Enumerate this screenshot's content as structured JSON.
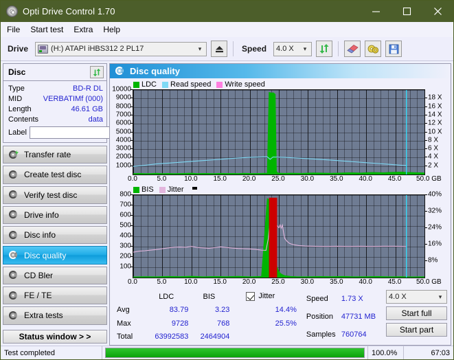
{
  "window": {
    "title": "Opti Drive Control 1.70",
    "app_icon": "disc-icon",
    "minimize": "minimize-icon",
    "maximize": "maximize-icon",
    "close": "close-icon"
  },
  "menu": {
    "items": [
      {
        "label": "File"
      },
      {
        "label": "Start test"
      },
      {
        "label": "Extra"
      },
      {
        "label": "Help"
      }
    ]
  },
  "toolbar": {
    "drive_label": "Drive",
    "drive_value": "(H:)   ATAPI iHBS312  2 PL17",
    "eject_icon": "eject-icon",
    "speed_label": "Speed",
    "speed_value": "4.0 X",
    "refresh_icon": "refresh-icon",
    "erase_icon": "eraser-icon",
    "disc_tools_icon": "disc-tools-icon",
    "save_icon": "save-icon"
  },
  "disc_panel": {
    "title": "Disc",
    "refresh_icon": "refresh-icon",
    "rows": [
      {
        "key": "Type",
        "value": "BD-R DL"
      },
      {
        "key": "MID",
        "value": "VERBATIMf (000)"
      },
      {
        "key": "Length",
        "value": "46.61 GB"
      },
      {
        "key": "Contents",
        "value": "data"
      }
    ],
    "label_key": "Label",
    "label_value": "",
    "label_placeholder": "",
    "label_button_icon": "disc-icon"
  },
  "sidebar": {
    "items": [
      {
        "label": "Transfer rate",
        "active": false
      },
      {
        "label": "Create test disc",
        "active": false
      },
      {
        "label": "Verify test disc",
        "active": false
      },
      {
        "label": "Drive info",
        "active": false
      },
      {
        "label": "Disc info",
        "active": false
      },
      {
        "label": "Disc quality",
        "active": true
      },
      {
        "label": "CD Bler",
        "active": false
      },
      {
        "label": "FE / TE",
        "active": false
      },
      {
        "label": "Extra tests",
        "active": false
      }
    ],
    "status_window_button": "Status window > >"
  },
  "main": {
    "title": "Disc quality",
    "icon": "disc-quality-icon"
  },
  "stats": {
    "col_headers": [
      "LDC",
      "BIS"
    ],
    "rows": [
      {
        "key": "Avg",
        "ldc": "83.79",
        "bis": "3.23",
        "jitter": "14.4%"
      },
      {
        "key": "Max",
        "ldc": "9728",
        "bis": "768",
        "jitter": "25.5%"
      },
      {
        "key": "Total",
        "ldc": "63992583",
        "bis": "2464904",
        "jitter": ""
      }
    ],
    "jitter_label": "Jitter",
    "jitter_checked": true,
    "speed_label": "Speed",
    "speed_value": "1.73 X",
    "position_label": "Position",
    "position_value": "47731 MB",
    "samples_label": "Samples",
    "samples_value": "760764",
    "speed_select": "4.0 X",
    "start_full": "Start full",
    "start_part": "Start part"
  },
  "statusbar": {
    "message": "Test completed",
    "progress_percent": 100,
    "progress_text": "100.0%",
    "elapsed": "67:03"
  },
  "colors": {
    "titlebar": "#4c5e2a",
    "accent_blue": "#2323d0",
    "ldc_green": "#00b400",
    "bis_green": "#00b400",
    "read_speed": "#7fd9f5",
    "write_speed": "#ff7fe0",
    "jitter_pink": "#e3b6dd",
    "marker_cyan": "#33e0ff",
    "spike_red": "#cc0000",
    "plot_bg": "#6f7c93",
    "progress_green": "#0aa30a"
  },
  "chart_data": [
    {
      "type": "area",
      "id": "ldc-chart",
      "title": "LDC / Read speed",
      "xlabel": "GB",
      "ylabel": "LDC",
      "xlim": [
        0,
        50
      ],
      "ylim": [
        0,
        10000
      ],
      "y2lim": [
        0,
        20
      ],
      "y2label": "X",
      "grid": true,
      "legend": [
        "LDC",
        "Read speed",
        "Write speed"
      ],
      "legend_position": "top-left",
      "xticks": [
        "0.0",
        "5.0",
        "10.0",
        "15.0",
        "20.0",
        "25.0",
        "30.0",
        "35.0",
        "40.0",
        "45.0",
        "50.0 GB"
      ],
      "yticks": [
        "10000",
        "9000",
        "8000",
        "7000",
        "6000",
        "5000",
        "4000",
        "3000",
        "2000",
        "1000"
      ],
      "y2ticks": [
        "18 X",
        "16 X",
        "14 X",
        "12 X",
        "10 X",
        "8 X",
        "6 X",
        "4 X",
        "2 X"
      ],
      "series": [
        {
          "name": "LDC",
          "color": "#00b400",
          "kind": "bars",
          "x": [
            0,
            1,
            2,
            3,
            4,
            5,
            6,
            7,
            8,
            9,
            10,
            11,
            12,
            13,
            14,
            15,
            16,
            17,
            18,
            19,
            20,
            21,
            22,
            23,
            23.3,
            23.5,
            23.8,
            24.0,
            24.2,
            24.4,
            24.6,
            24.8,
            25.0,
            25.4,
            26,
            27,
            28,
            29,
            30,
            31,
            32,
            33,
            34,
            35,
            36,
            37,
            38,
            39,
            40,
            41,
            42,
            43,
            44,
            45,
            46,
            47,
            48,
            49,
            50
          ],
          "values": [
            120,
            150,
            110,
            130,
            160,
            120,
            140,
            110,
            130,
            150,
            170,
            120,
            140,
            130,
            120,
            150,
            130,
            140,
            120,
            160,
            140,
            130,
            150,
            170,
            9728,
            9700,
            9650,
            9700,
            9600,
            9500,
            400,
            200,
            180,
            160,
            150,
            170,
            160,
            150,
            180,
            200,
            190,
            170,
            160,
            180,
            200,
            220,
            210,
            190,
            230,
            250,
            240,
            220,
            260,
            280,
            300,
            260,
            240,
            220,
            200
          ]
        },
        {
          "name": "Read speed",
          "color": "#7fd9f5",
          "kind": "line",
          "x": [
            0,
            2,
            4,
            6,
            8,
            10,
            12,
            14,
            16,
            18,
            20,
            22,
            23,
            23.5,
            24,
            25,
            26,
            28,
            30,
            32,
            34,
            36,
            38,
            40,
            42,
            44,
            46,
            47
          ],
          "values": [
            1.9,
            2.2,
            2.5,
            2.7,
            2.9,
            3.1,
            3.3,
            3.5,
            3.7,
            3.9,
            4.05,
            4.15,
            4.2,
            3.6,
            4.15,
            4.1,
            4.05,
            3.9,
            3.75,
            3.6,
            3.4,
            3.2,
            3.0,
            2.8,
            2.6,
            2.4,
            2.2,
            2.1
          ]
        },
        {
          "name": "Write speed",
          "color": "#ff7fe0",
          "kind": "line",
          "x": [],
          "values": []
        },
        {
          "name": "End marker",
          "color": "#33e0ff",
          "kind": "vline",
          "x": [
            46.9
          ],
          "values": []
        }
      ]
    },
    {
      "type": "area",
      "id": "bis-jitter-chart",
      "title": "BIS / Jitter",
      "xlabel": "GB",
      "ylabel": "BIS",
      "xlim": [
        0,
        50
      ],
      "ylim": [
        0,
        800
      ],
      "y2lim": [
        0,
        40
      ],
      "y2label": "%",
      "grid": true,
      "legend": [
        "BIS",
        "Jitter"
      ],
      "legend_position": "top-left",
      "xticks": [
        "0.0",
        "5.0",
        "10.0",
        "15.0",
        "20.0",
        "25.0",
        "30.0",
        "35.0",
        "40.0",
        "45.0",
        "50.0 GB"
      ],
      "yticks": [
        "800",
        "700",
        "600",
        "500",
        "400",
        "300",
        "200",
        "100"
      ],
      "y2ticks": [
        "40%",
        "32%",
        "24%",
        "16%",
        "8%"
      ],
      "series": [
        {
          "name": "BIS",
          "color": "#00b400",
          "kind": "bars",
          "x": [
            0,
            2,
            4,
            6,
            8,
            10,
            12,
            14,
            16,
            18,
            20,
            22,
            23,
            23.3,
            23.5,
            23.8,
            24.0,
            24.3,
            24.6,
            25.0,
            25.3,
            25.6,
            26,
            27,
            28,
            30,
            32,
            34,
            36,
            38,
            40,
            42,
            44,
            46,
            48,
            50
          ],
          "values": [
            8,
            10,
            9,
            12,
            10,
            14,
            9,
            11,
            10,
            13,
            9,
            12,
            768,
            760,
            740,
            755,
            730,
            700,
            120,
            60,
            40,
            30,
            20,
            12,
            10,
            9,
            11,
            10,
            12,
            9,
            10,
            11,
            9,
            10,
            8,
            9
          ]
        },
        {
          "name": "Jitter",
          "color": "#e3b6dd",
          "kind": "line",
          "x": [
            0,
            1,
            2,
            3,
            4,
            5,
            6,
            7,
            8,
            9,
            10,
            11,
            12,
            13,
            14,
            15,
            16,
            17,
            18,
            19,
            20,
            21,
            22,
            22.8,
            23.2,
            23.4,
            24.2,
            24.6,
            25.0,
            25.2,
            25.4,
            25.6,
            25.8,
            26.0,
            26.4,
            26.8,
            27.2,
            27.8,
            28.5,
            29.5,
            31,
            33,
            35,
            37,
            39,
            41,
            43,
            45,
            46.5,
            47
          ],
          "values": [
            12.3,
            12.8,
            13.0,
            13.3,
            13.6,
            14.0,
            14.4,
            14.7,
            14.8,
            14.7,
            15.1,
            14.6,
            14.4,
            14.2,
            14.5,
            14.9,
            14.6,
            14.3,
            14.1,
            14.0,
            13.9,
            13.7,
            13.3,
            13.2,
            19.0,
            25.5,
            25.5,
            25.5,
            24.2,
            25.6,
            24.0,
            25.5,
            22.0,
            19.0,
            17.6,
            16.6,
            16.2,
            15.8,
            15.5,
            15.3,
            15.2,
            15.1,
            15.2,
            15.1,
            15.2,
            15.1,
            15.2,
            15.2,
            15.1,
            15.0
          ]
        },
        {
          "name": "Error spike",
          "color": "#cc0000",
          "kind": "band",
          "x": [
            23.3,
            24.7
          ],
          "values": [
            775
          ]
        },
        {
          "name": "End marker",
          "color": "#33e0ff",
          "kind": "vline",
          "x": [
            46.9
          ],
          "values": []
        }
      ]
    }
  ]
}
